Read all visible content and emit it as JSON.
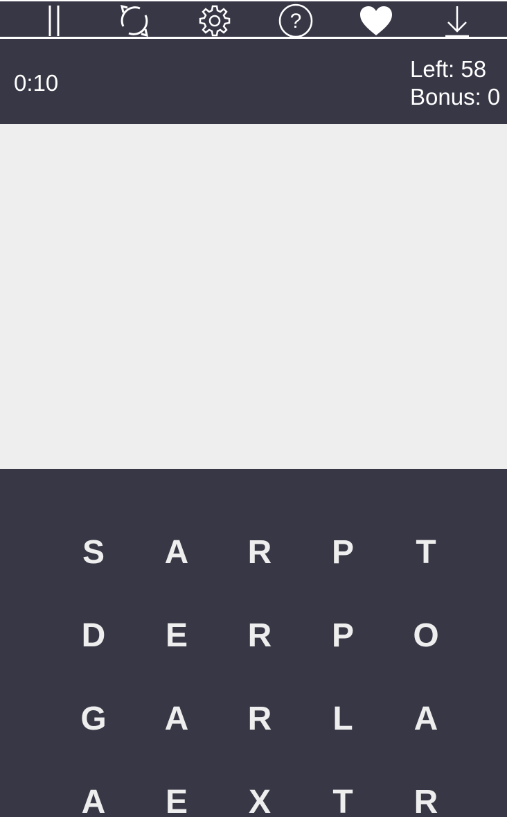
{
  "toolbar": {
    "items": [
      {
        "name": "pause-icon",
        "label": "Pause"
      },
      {
        "name": "restart-icon",
        "label": "Restart"
      },
      {
        "name": "settings-icon",
        "label": "Settings"
      },
      {
        "name": "help-icon",
        "label": "Help"
      },
      {
        "name": "heart-icon",
        "label": "Favorite"
      },
      {
        "name": "download-icon",
        "label": "Download"
      }
    ]
  },
  "status": {
    "timer": "0:10",
    "left": "Left: 58",
    "bonus": "Bonus: 0"
  },
  "board": {
    "rows": [
      [
        "S",
        "A",
        "R",
        "P",
        "T"
      ],
      [
        "D",
        "E",
        "R",
        "P",
        "O"
      ],
      [
        "G",
        "A",
        "R",
        "L",
        "A"
      ],
      [
        "A",
        "E",
        "X",
        "T",
        "R"
      ]
    ]
  },
  "colors": {
    "panel": "#383746",
    "found_area": "#eeeeee",
    "letters": "#eeeeee"
  }
}
